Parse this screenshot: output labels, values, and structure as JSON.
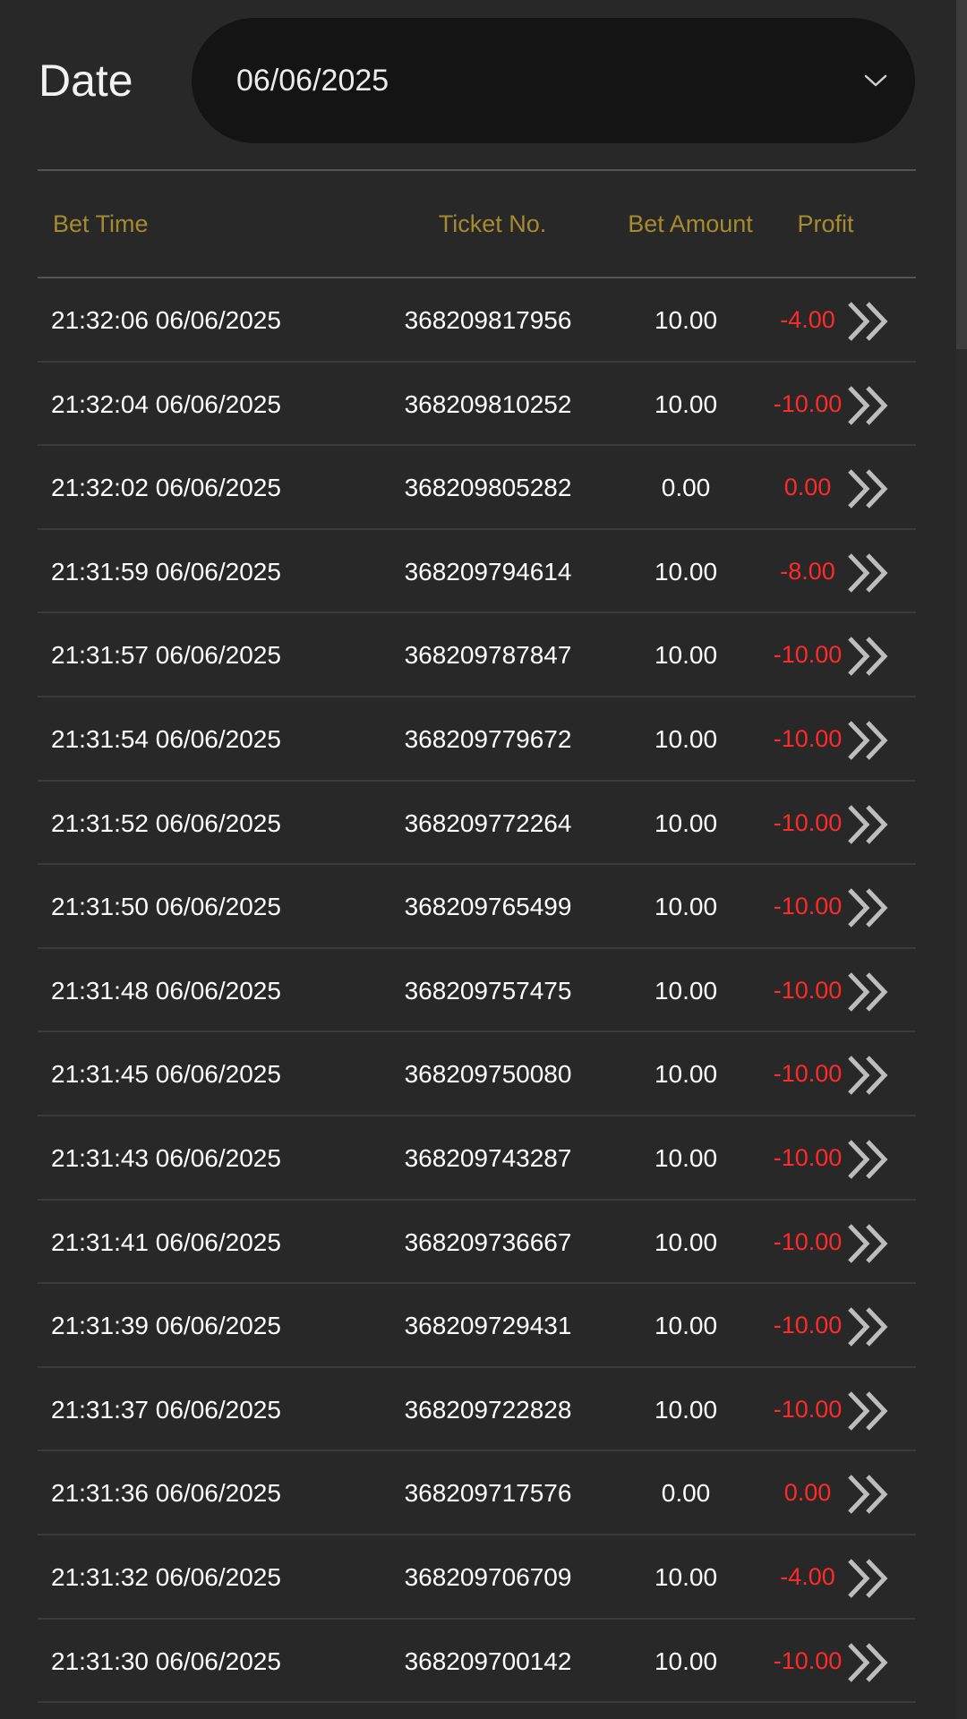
{
  "filter": {
    "date_label": "Date",
    "date_value": "06/06/2025"
  },
  "table": {
    "headers": {
      "bet_time": "Bet Time",
      "ticket_no": "Ticket No.",
      "bet_amount": "Bet Amount",
      "profit": "Profit"
    },
    "rows": [
      {
        "bet_time": "21:32:06 06/06/2025",
        "ticket_no": "368209817956",
        "bet_amount": "10.00",
        "profit": "-4.00"
      },
      {
        "bet_time": "21:32:04 06/06/2025",
        "ticket_no": "368209810252",
        "bet_amount": "10.00",
        "profit": "-10.00"
      },
      {
        "bet_time": "21:32:02 06/06/2025",
        "ticket_no": "368209805282",
        "bet_amount": "0.00",
        "profit": "0.00"
      },
      {
        "bet_time": "21:31:59 06/06/2025",
        "ticket_no": "368209794614",
        "bet_amount": "10.00",
        "profit": "-8.00"
      },
      {
        "bet_time": "21:31:57 06/06/2025",
        "ticket_no": "368209787847",
        "bet_amount": "10.00",
        "profit": "-10.00"
      },
      {
        "bet_time": "21:31:54 06/06/2025",
        "ticket_no": "368209779672",
        "bet_amount": "10.00",
        "profit": "-10.00"
      },
      {
        "bet_time": "21:31:52 06/06/2025",
        "ticket_no": "368209772264",
        "bet_amount": "10.00",
        "profit": "-10.00"
      },
      {
        "bet_time": "21:31:50 06/06/2025",
        "ticket_no": "368209765499",
        "bet_amount": "10.00",
        "profit": "-10.00"
      },
      {
        "bet_time": "21:31:48 06/06/2025",
        "ticket_no": "368209757475",
        "bet_amount": "10.00",
        "profit": "-10.00"
      },
      {
        "bet_time": "21:31:45 06/06/2025",
        "ticket_no": "368209750080",
        "bet_amount": "10.00",
        "profit": "-10.00"
      },
      {
        "bet_time": "21:31:43 06/06/2025",
        "ticket_no": "368209743287",
        "bet_amount": "10.00",
        "profit": "-10.00"
      },
      {
        "bet_time": "21:31:41 06/06/2025",
        "ticket_no": "368209736667",
        "bet_amount": "10.00",
        "profit": "-10.00"
      },
      {
        "bet_time": "21:31:39 06/06/2025",
        "ticket_no": "368209729431",
        "bet_amount": "10.00",
        "profit": "-10.00"
      },
      {
        "bet_time": "21:31:37 06/06/2025",
        "ticket_no": "368209722828",
        "bet_amount": "10.00",
        "profit": "-10.00"
      },
      {
        "bet_time": "21:31:36 06/06/2025",
        "ticket_no": "368209717576",
        "bet_amount": "0.00",
        "profit": "0.00"
      },
      {
        "bet_time": "21:31:32 06/06/2025",
        "ticket_no": "368209706709",
        "bet_amount": "10.00",
        "profit": "-4.00"
      },
      {
        "bet_time": "21:31:30 06/06/2025",
        "ticket_no": "368209700142",
        "bet_amount": "10.00",
        "profit": "-10.00"
      }
    ]
  },
  "icons": {
    "dropdown": "chevron-down-icon",
    "row_detail": "double-chevron-right-icon"
  },
  "colors": {
    "background": "#282828",
    "header_text": "#a58a2f",
    "profit_negative": "#ff2a2a",
    "select_background": "#141414"
  }
}
